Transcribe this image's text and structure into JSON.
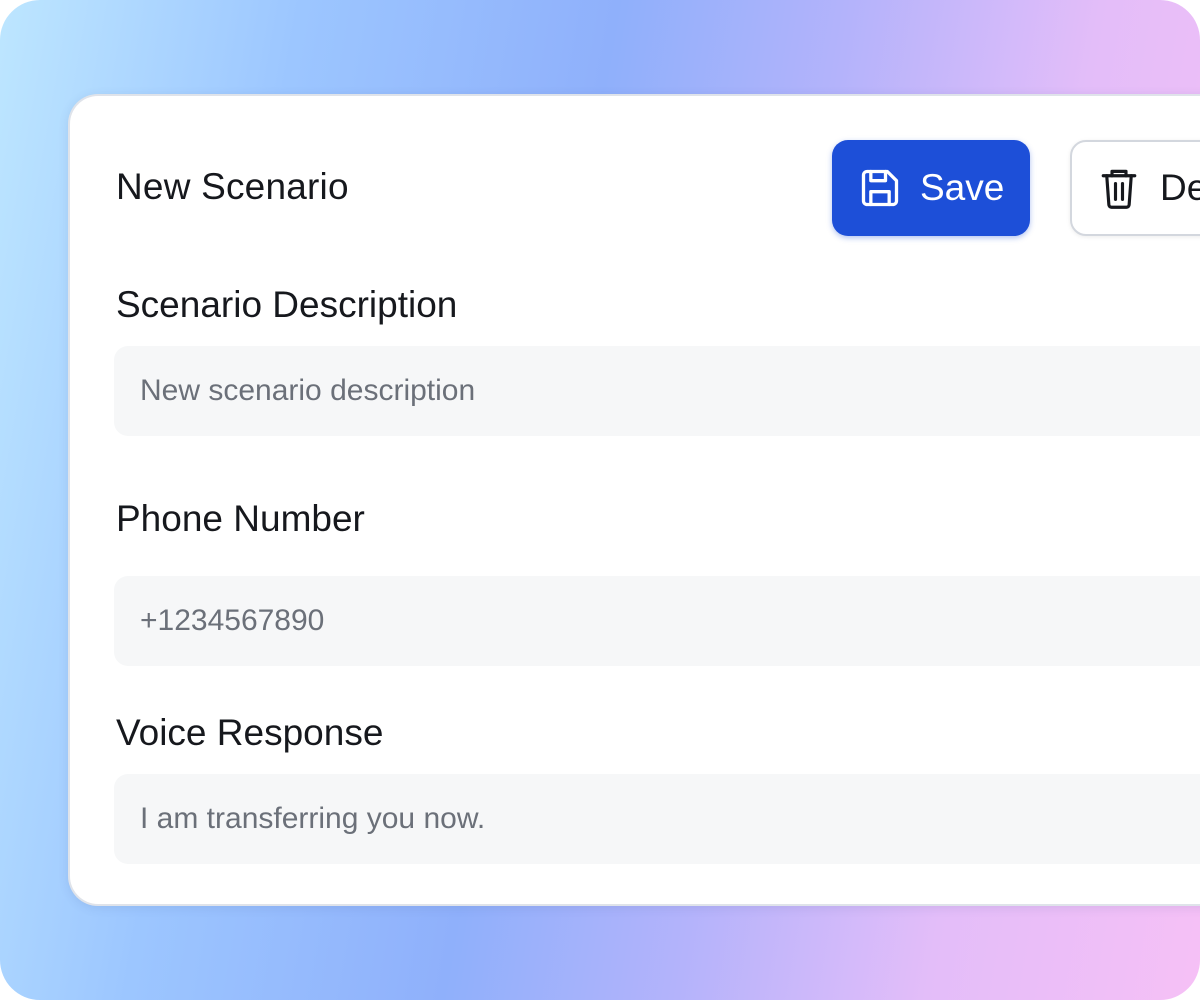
{
  "form": {
    "title": "New Scenario",
    "actions": {
      "save_label": "Save",
      "delete_label": "De",
      "save_icon": "save-icon",
      "delete_icon": "trash-icon"
    },
    "fields": [
      {
        "label": "Scenario Description",
        "value": "New scenario description"
      },
      {
        "label": "Phone Number",
        "value": "+1234567890"
      },
      {
        "label": "Voice Response",
        "value": "I am transferring you now."
      }
    ]
  },
  "colors": {
    "primary": "#1d4fd8",
    "field_bg": "#f6f7f8",
    "text": "#16181d",
    "muted_text": "#6b7079"
  }
}
